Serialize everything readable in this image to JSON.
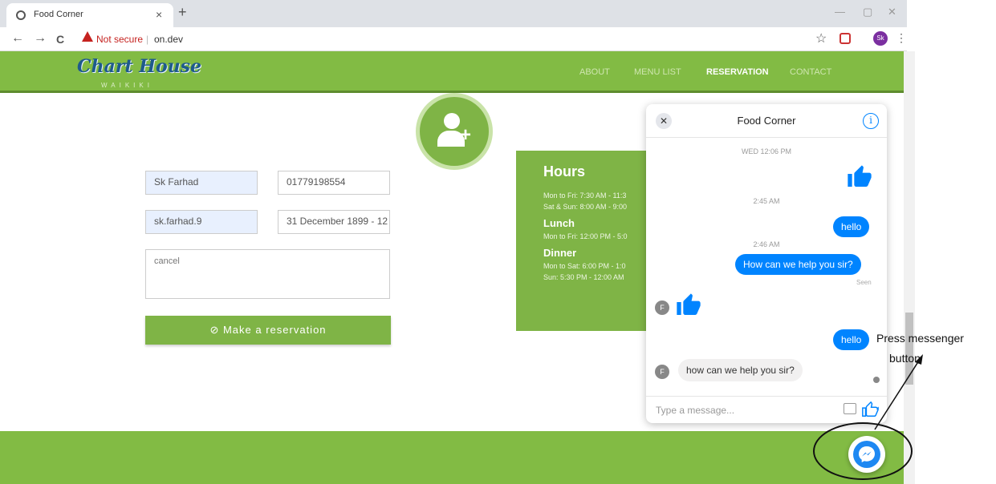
{
  "browser": {
    "tab_title": "Food Corner",
    "tab_close": "×",
    "new_tab": "+",
    "min": "—",
    "max": "▢",
    "close": "✕",
    "back": "←",
    "forward": "→",
    "reload": "C",
    "security_warning": "Not secure",
    "separator": "|",
    "url": "on.dev",
    "avatar_initials": "Sk",
    "star": "☆",
    "menu": "⋮"
  },
  "site": {
    "logo": "Chart House",
    "logo_sub": "WAIKIKI",
    "nav": [
      "ABOUT",
      "MENU LIST",
      "RESERVATION",
      "CONTACT"
    ],
    "active_nav": "RESERVATION"
  },
  "form": {
    "name": "Sk Farhad",
    "phone": "01779198554",
    "email": "sk.farhad.9",
    "date": "31 December 1899 - 12",
    "message": "cancel",
    "submit_label": "⊘ Make a reservation"
  },
  "hours": {
    "title": "Hours",
    "lines_general": [
      "Mon to Fri: 7:30 AM - 11:3",
      "Sat & Sun: 8:00 AM - 9:00"
    ],
    "lunch_title": "Lunch",
    "lunch_lines": [
      "Mon to Fri: 12:00 PM - 5:0"
    ],
    "dinner_title": "Dinner",
    "dinner_lines": [
      "Mon to Sat: 6:00 PM - 1:0",
      "Sun: 5:30 PM - 12:00 AM"
    ]
  },
  "messenger": {
    "title": "Food Corner",
    "close": "✕",
    "info": "i",
    "timestamps": [
      "WED 12:06 PM",
      "2:45 AM",
      "2:46 AM"
    ],
    "msg_hello_1": "hello",
    "msg_help": "How can we help you sir?",
    "seen": "Seen",
    "msg_hello_2": "hello",
    "reply": "how can we help you sir?",
    "avatar_letter": "F",
    "input_placeholder": "Type a message..."
  },
  "annotation": {
    "line1": "Press messenger",
    "line2": "button"
  },
  "colors": {
    "green": "#82bb44",
    "messenger_blue": "#0084ff"
  }
}
